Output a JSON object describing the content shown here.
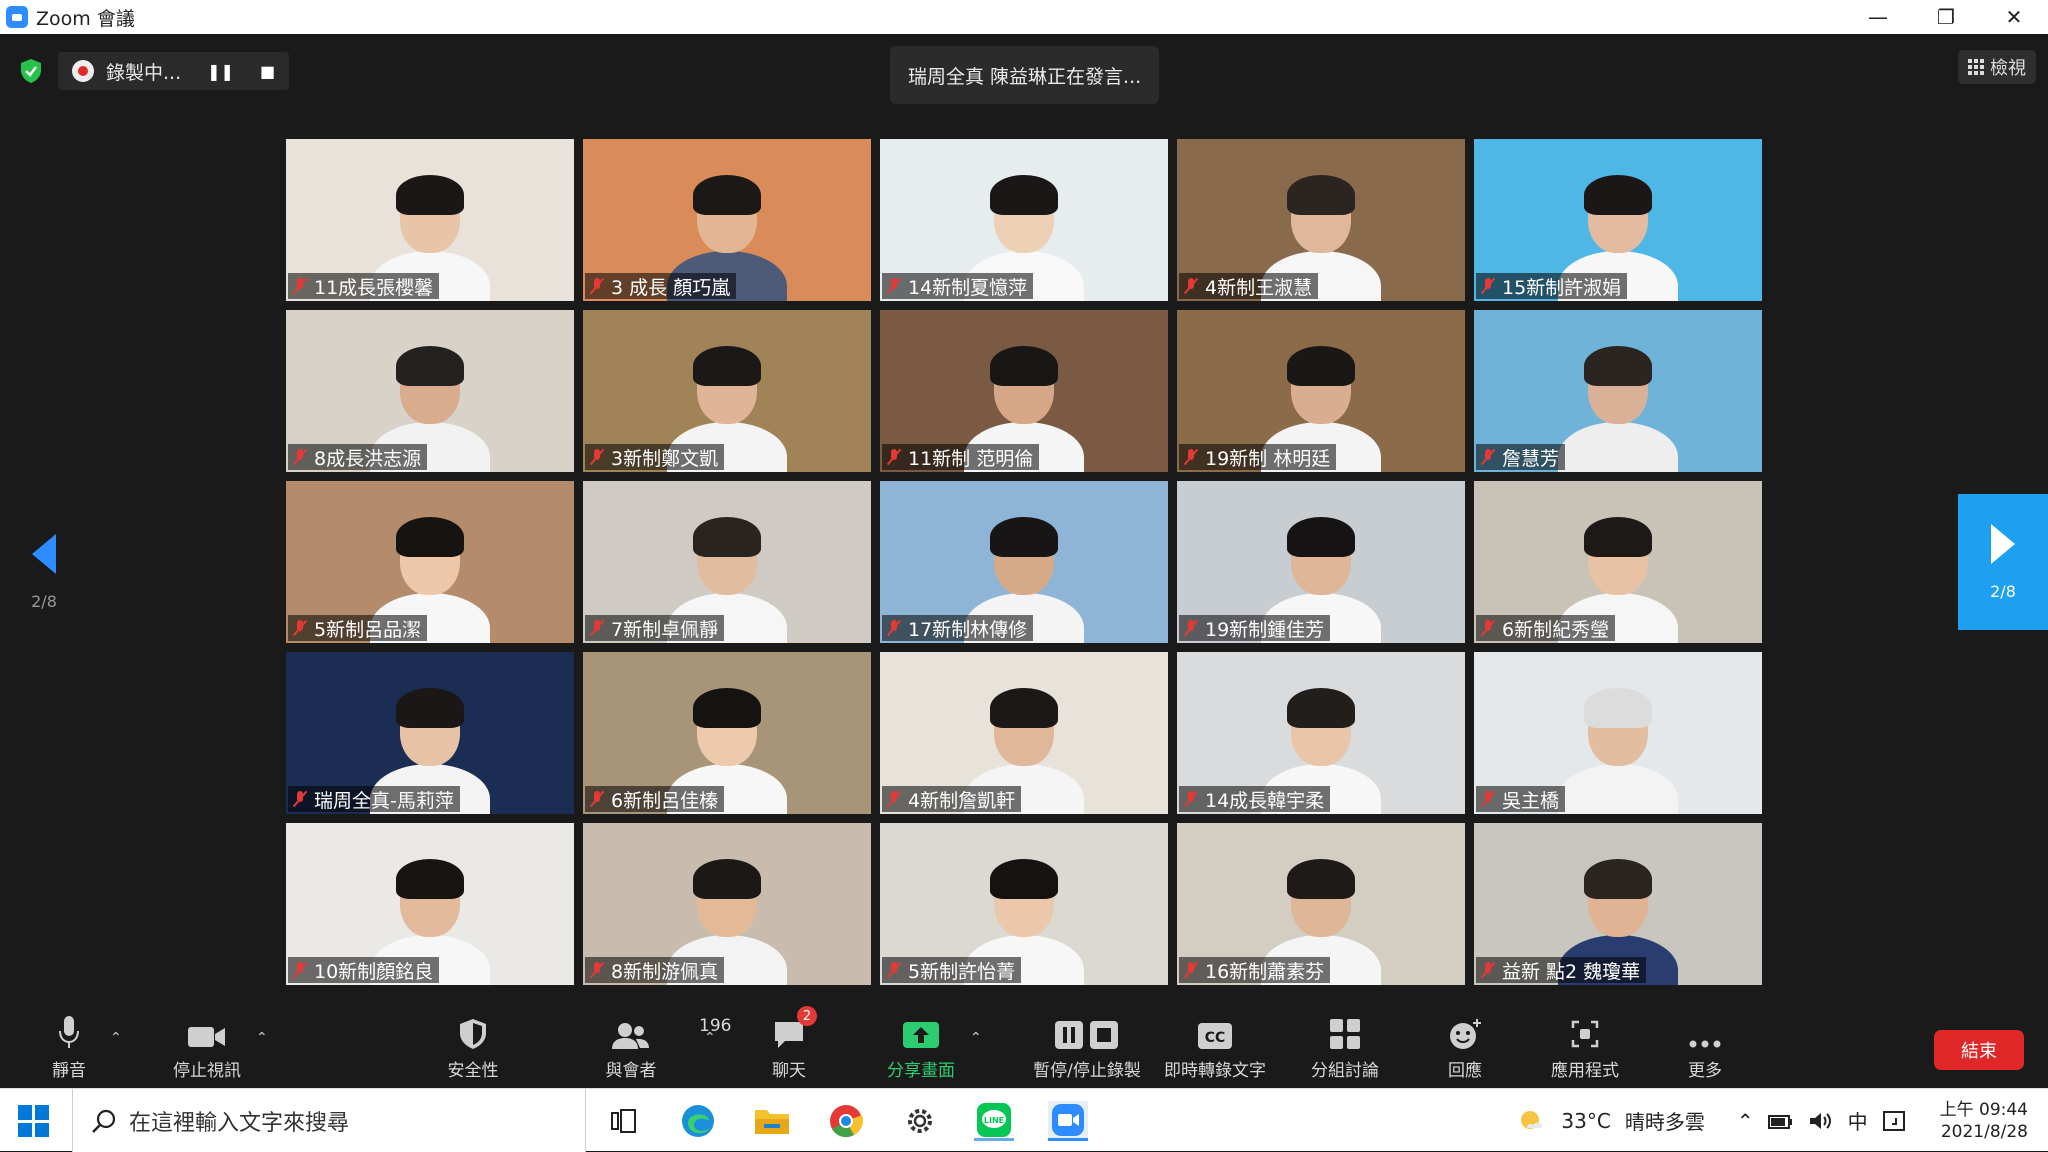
{
  "window": {
    "title": "Zoom 會議"
  },
  "recording": {
    "label": "錄製中..."
  },
  "speaking_banner": "瑞周全真 陳益琳正在發言...",
  "view_button": "檢視",
  "pagination": {
    "current": "2/8"
  },
  "participants": [
    {
      "name": "11成長張櫻馨",
      "bg": "#e8e2da",
      "skin": "#e8c4a8",
      "hair": "#1a1716",
      "shirt": "#f7f7f7"
    },
    {
      "name": "3 成長 顏巧嵐",
      "bg": "#d98c5a",
      "skin": "#e3b592",
      "hair": "#1c1816",
      "shirt": "#4d5a78"
    },
    {
      "name": "14新制夏憶萍",
      "bg": "#e7ecef",
      "skin": "#edd0b6",
      "hair": "#1b1716",
      "shirt": "#f8f8f8"
    },
    {
      "name": "4新制王淑慧",
      "bg": "#8a6a4c",
      "skin": "#dfb79a",
      "hair": "#2b2420",
      "shirt": "#f6f6f6"
    },
    {
      "name": "15新制許淑娟",
      "bg": "#4fb7e6",
      "skin": "#e2bba0",
      "hair": "#1a1716",
      "shirt": "#f7f7f7"
    },
    {
      "name": "8成長洪志源",
      "bg": "#d8d2c8",
      "skin": "#d9ac8d",
      "hair": "#232020",
      "shirt": "#f2f2f2"
    },
    {
      "name": "3新制鄭文凱",
      "bg": "#a08458",
      "skin": "#e0b496",
      "hair": "#1b1817",
      "shirt": "#f4f4f4"
    },
    {
      "name": "11新制 范明倫",
      "bg": "#7a5a42",
      "skin": "#d6a786",
      "hair": "#191716",
      "shirt": "#f5f5f5"
    },
    {
      "name": "19新制 林明廷",
      "bg": "#8c6b4a",
      "skin": "#d9ad8f",
      "hair": "#1a1817",
      "shirt": "#f4f4f4"
    },
    {
      "name": "詹慧芳",
      "bg": "#6fb3d9",
      "skin": "#d8b196",
      "hair": "#2b2522",
      "shirt": "#eeeeee"
    },
    {
      "name": "5新制呂品潔",
      "bg": "#b48c6c",
      "skin": "#ecc7aa",
      "hair": "#161413",
      "shirt": "#f7f7f7"
    },
    {
      "name": "7新制卓佩靜",
      "bg": "#cfcbc4",
      "skin": "#e1bc9f",
      "hair": "#2a2420",
      "shirt": "#f6f6f6"
    },
    {
      "name": "17新制林傳修",
      "bg": "#8eb4d6",
      "skin": "#d6aa88",
      "hair": "#171515",
      "shirt": "#f4f4f4"
    },
    {
      "name": "19新制鍾佳芳",
      "bg": "#c8cdd2",
      "skin": "#dfb698",
      "hair": "#151313",
      "shirt": "#f7f7f7"
    },
    {
      "name": "6新制紀秀瑩",
      "bg": "#c9c2b6",
      "skin": "#e8c2a4",
      "hair": "#1c1918",
      "shirt": "#f6f6f6"
    },
    {
      "name": "瑞周全真-馬莉萍",
      "bg": "#1b2d52",
      "skin": "#e6c2a6",
      "hair": "#1a1716",
      "shirt": "#f4f4f4"
    },
    {
      "name": "6新制呂佳榛",
      "bg": "#a89478",
      "skin": "#edc9ae",
      "hair": "#151312",
      "shirt": "#f7f7f7"
    },
    {
      "name": "4新制詹凱軒",
      "bg": "#e7e2da",
      "skin": "#e0b799",
      "hair": "#1b1817",
      "shirt": "#f5f5f5"
    },
    {
      "name": "14成長韓宇柔",
      "bg": "#d9dbdc",
      "skin": "#e9c6aa",
      "hair": "#221e1c",
      "shirt": "#f7f7f7"
    },
    {
      "name": "吳主橋",
      "bg": "#e4e8ea",
      "skin": "#e3bd9f",
      "hair": "#dcdcdc",
      "shirt": "#f3f3f3"
    },
    {
      "name": "10新制顏銘良",
      "bg": "#ebe9e6",
      "skin": "#e3bb9c",
      "hair": "#171514",
      "shirt": "#f7f7f7"
    },
    {
      "name": "8新制游佩真",
      "bg": "#c9bcae",
      "skin": "#e4b998",
      "hair": "#1c1816",
      "shirt": "#f3f3f3"
    },
    {
      "name": "5新制許怡菁",
      "bg": "#dcd8d2",
      "skin": "#ebc8ac",
      "hair": "#151312",
      "shirt": "#f7f7f7"
    },
    {
      "name": "16新制蕭素芬",
      "bg": "#d4cdc2",
      "skin": "#e0b699",
      "hair": "#1d1a18",
      "shirt": "#f5f5f5"
    },
    {
      "name": "益新 點2 魏瓊華",
      "bg": "#c9c6bf",
      "skin": "#dfb394",
      "hair": "#2a2521",
      "shirt": "#2a3d70"
    }
  ],
  "toolbar": {
    "mute": "靜音",
    "stop_video": "停止視訊",
    "security": "安全性",
    "participants": "與會者",
    "participant_count": "196",
    "chat": "聊天",
    "chat_badge": "2",
    "share": "分享畫面",
    "pause_record": "暫停/停止錄製",
    "captions": "即時轉錄文字",
    "breakout": "分組討論",
    "reactions": "回應",
    "apps": "應用程式",
    "more": "更多",
    "end": "結束"
  },
  "taskbar": {
    "search_placeholder": "在這裡輸入文字來搜尋",
    "weather_temp": "33°C",
    "weather_desc": "晴時多雲",
    "ime": "中",
    "time": "上午 09:44",
    "date": "2021/8/28"
  },
  "colors": {
    "accent": "#2d8cff",
    "end": "#e02828",
    "share_green": "#2ecc71",
    "muted": "#e53935"
  }
}
